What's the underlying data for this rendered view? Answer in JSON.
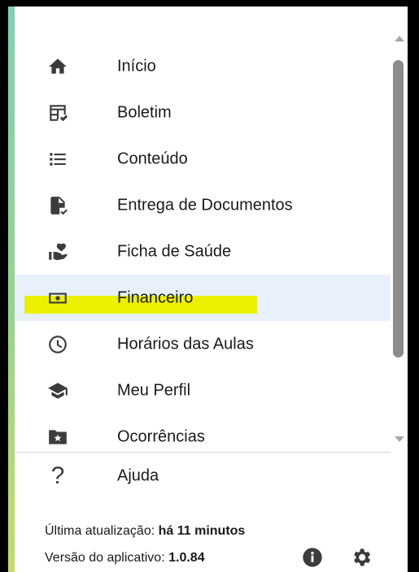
{
  "menu": {
    "items": [
      {
        "label": "Início",
        "icon": "home-icon"
      },
      {
        "label": "Boletim",
        "icon": "report-card-icon"
      },
      {
        "label": "Conteúdo",
        "icon": "list-icon"
      },
      {
        "label": "Entrega de Documentos",
        "icon": "document-check-icon"
      },
      {
        "label": "Ficha de Saúde",
        "icon": "health-hand-heart-icon"
      },
      {
        "label": "Financeiro",
        "icon": "money-icon",
        "selected": true
      },
      {
        "label": "Horários das Aulas",
        "icon": "clock-icon"
      },
      {
        "label": "Meu Perfil",
        "icon": "graduation-cap-icon"
      },
      {
        "label": "Ocorrências",
        "icon": "folder-star-icon"
      }
    ],
    "help": {
      "label": "Ajuda",
      "icon": "question-icon"
    }
  },
  "footer": {
    "last_update_label": "Última atualização:",
    "last_update_value": "há 11 minutos",
    "version_label": "Versão do aplicativo:",
    "version_value": "1.0.84"
  },
  "colors": {
    "selected_background": "#e8f0fb",
    "highlight_marker": "#ebf000",
    "icon": "#3c3c3c"
  }
}
